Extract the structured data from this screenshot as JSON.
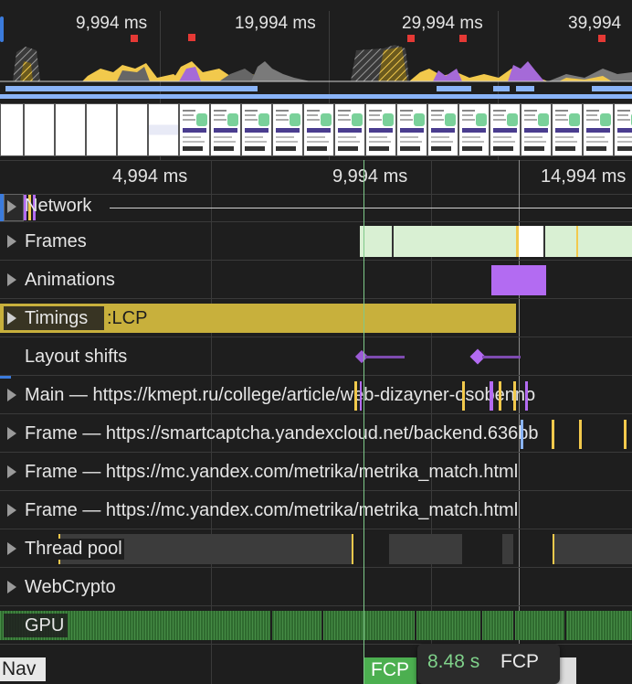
{
  "overview": {
    "ticks": [
      "9,994 ms",
      "19,994 ms",
      "29,994 ms",
      "39,994"
    ]
  },
  "ruler": {
    "ticks": [
      "4,994 ms",
      "9,994 ms",
      "14,994 ms"
    ]
  },
  "tracks": {
    "network": "Network",
    "frames": "Frames",
    "animations": "Animations",
    "timings": "Timings",
    "timings_lcp": ":LCP",
    "layout_shifts": "Layout shifts",
    "main": "Main — https://kmept.ru/college/article/web-dizayner-osobenno",
    "frame1": "Frame — https://smartcaptcha.yandexcloud.net/backend.636bb",
    "frame2": "Frame — https://mc.yandex.com/metrika/metrika_match.html",
    "frame3": "Frame — https://mc.yandex.com/metrika/metrika_match.html",
    "thread_pool": "Thread pool",
    "webcrypto": "WebCrypto",
    "gpu": "GPU",
    "nav": "Nav"
  },
  "tooltip": {
    "fcp_badge": "FCP",
    "time": "8.48 s",
    "label": "FCP"
  },
  "colors": {
    "frames": "#d9f0d3",
    "animation": "#b36bf2",
    "timings": "#c8b03c",
    "layout_shift": "#9c5bd6",
    "gpu": "#3d8a3d",
    "fcp": "#4caf50",
    "network_bar": "#8ab4f8"
  }
}
